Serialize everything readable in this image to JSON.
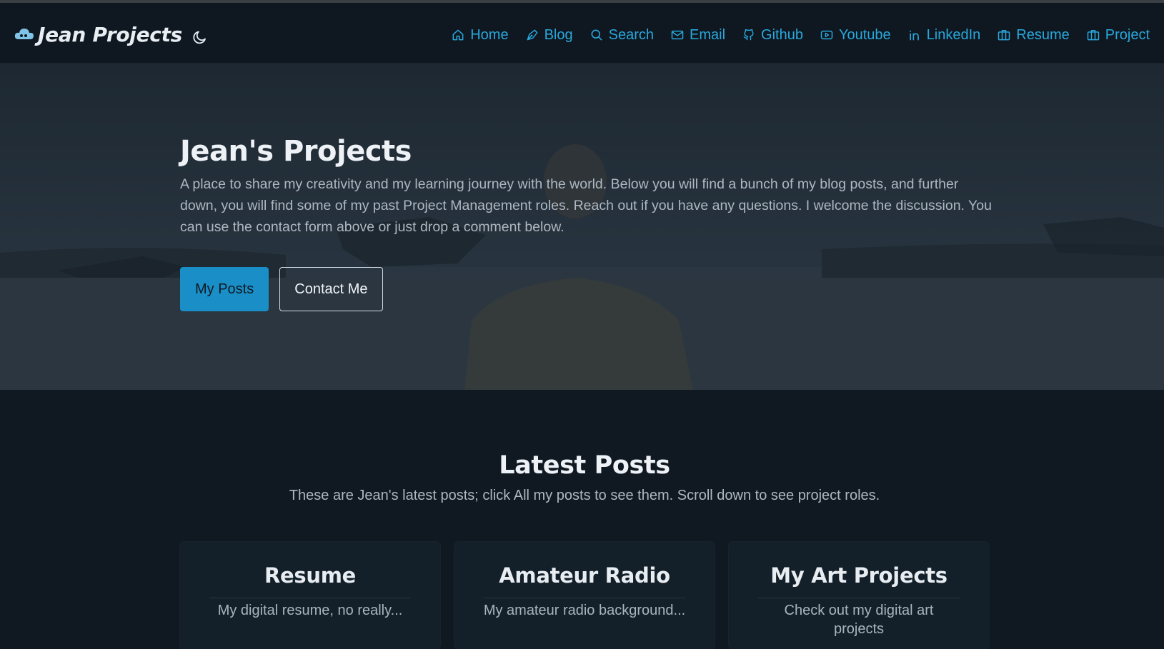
{
  "brand": {
    "name": "Jean Projects",
    "icon": "cloud-icon"
  },
  "theme_toggle": {
    "icon": "moon-icon"
  },
  "nav": {
    "items": [
      {
        "label": "Home",
        "icon": "home-icon"
      },
      {
        "label": "Blog",
        "icon": "pen-icon"
      },
      {
        "label": "Search",
        "icon": "search-icon"
      },
      {
        "label": "Email",
        "icon": "mail-icon"
      },
      {
        "label": "Github",
        "icon": "github-icon"
      },
      {
        "label": "Youtube",
        "icon": "youtube-icon"
      },
      {
        "label": "LinkedIn",
        "icon": "linkedin-icon"
      },
      {
        "label": "Resume",
        "icon": "briefcase-icon"
      },
      {
        "label": "Project",
        "icon": "briefcase-icon"
      }
    ]
  },
  "hero": {
    "title": "Jean's Projects",
    "lead": "A place to share my creativity and my learning journey with the world. Below you will find a bunch of my blog posts, and further down, you will find some of my past Project Management roles. Reach out if you have any questions. I welcome the discussion. You can use the contact form above or just drop a comment below.",
    "primary_button": "My Posts",
    "secondary_button": "Contact Me"
  },
  "latest": {
    "title": "Latest Posts",
    "subtitle": "These are Jean's latest posts; click All my posts to see them. Scroll down to see project roles.",
    "cards": [
      {
        "title": "Resume",
        "text": "My digital resume, no really..."
      },
      {
        "title": "Amateur Radio",
        "text": "My amateur radio background..."
      },
      {
        "title": "My Art Projects",
        "text": "Check out my digital art projects"
      }
    ]
  },
  "colors": {
    "accent": "#1a8fc7",
    "nav_link": "#29a8dc",
    "background": "#101922",
    "navbar": "#0f1720"
  }
}
